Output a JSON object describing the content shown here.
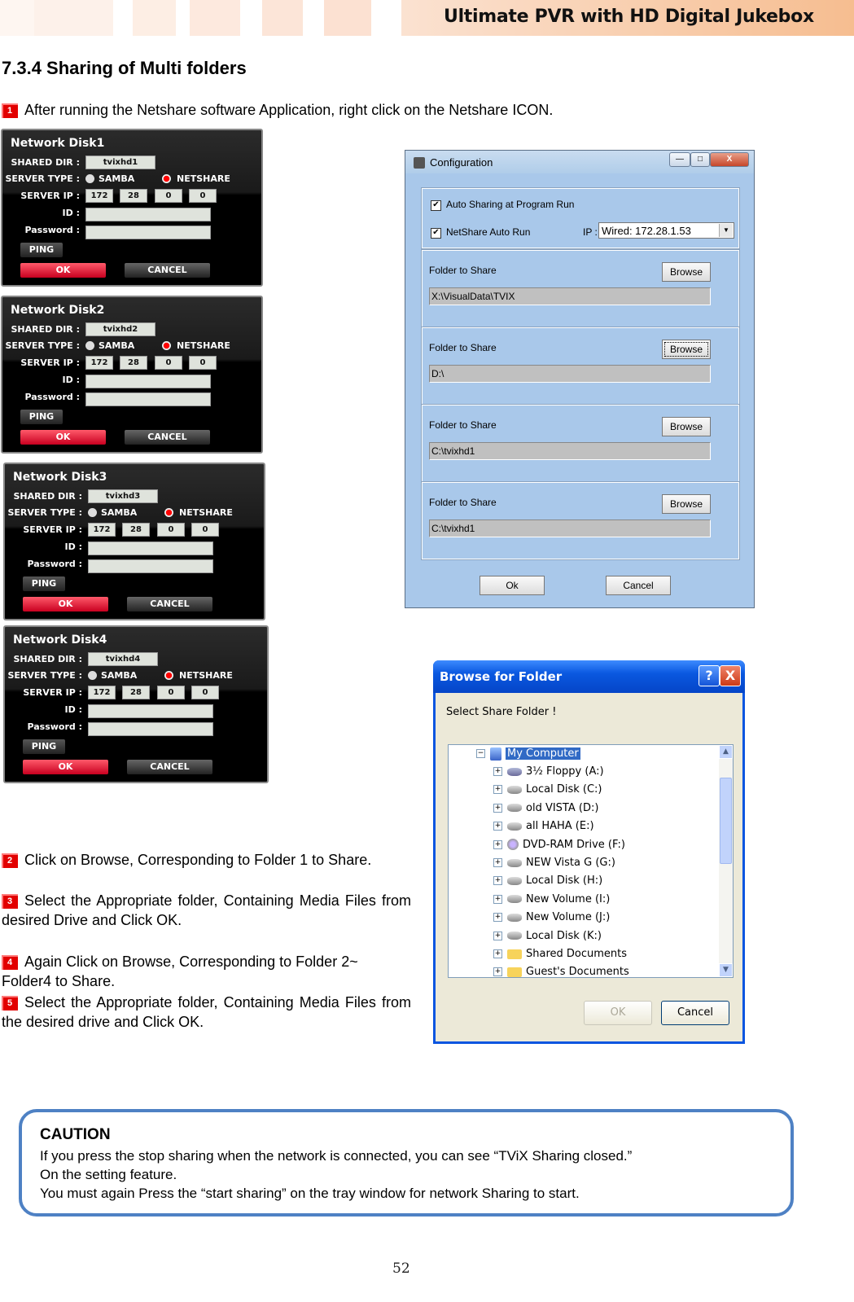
{
  "header": {
    "title": "Ultimate PVR with HD Digital Jukebox",
    "band_color": "#f6bd90"
  },
  "section_title": "7.3.4 Sharing of Multi folders",
  "steps": [
    {
      "num": "1",
      "text": "After running the Netshare software Application, right click on the Netshare ICON."
    },
    {
      "num": "2",
      "text": "Click on Browse, Corresponding to Folder 1 to Share."
    },
    {
      "num": "3",
      "text": "Select the Appropriate folder, Containing Media Files from desired Drive and Click OK."
    },
    {
      "num": "4",
      "text": "Again Click on Browse, Corresponding to Folder 2~ Folder4 to Share."
    },
    {
      "num": "5",
      "text": "Select the Appropriate folder, Containing Media Files from the desired drive and Click OK."
    }
  ],
  "network_disks": [
    {
      "title": "Network Disk1",
      "shared_dir": "tvixhd1",
      "ip": [
        "172",
        "28",
        "0",
        "0"
      ]
    },
    {
      "title": "Network Disk2",
      "shared_dir": "tvixhd2",
      "ip": [
        "172",
        "28",
        "0",
        "0"
      ]
    },
    {
      "title": "Network Disk3",
      "shared_dir": "tvixhd3",
      "ip": [
        "172",
        "28",
        "0",
        "0"
      ]
    },
    {
      "title": "Network Disk4",
      "shared_dir": "tvixhd4",
      "ip": [
        "172",
        "28",
        "0",
        "0"
      ]
    }
  ],
  "disk_labels": {
    "shared_dir": "SHARED DIR  :",
    "server_type": "SERVER TYPE :",
    "server_ip": "SERVER IP :",
    "id": "ID :",
    "password": "Password :",
    "samba": "SAMBA",
    "netshare": "NETSHARE",
    "selected_type": "NETSHARE",
    "ping": "PING",
    "ok": "OK",
    "cancel": "CANCEL"
  },
  "config_window": {
    "title": "Configuration",
    "minimize": "—",
    "maximize": "□",
    "close": "X",
    "auto_sharing_label": "Auto Sharing at Program Run",
    "auto_sharing_checked": true,
    "netshare_autorun_label": "NetShare  Auto Run",
    "netshare_autorun_checked": true,
    "ip_label": "IP :",
    "ip_value": "Wired: 172.28.1.53",
    "folders": [
      {
        "label": "Folder to Share",
        "path": "X:\\VisualData\\TVIX",
        "browse": "Browse"
      },
      {
        "label": "Folder to Share",
        "path": "D:\\",
        "browse": "Browse"
      },
      {
        "label": "Folder to Share",
        "path": "C:\\tvixhd1",
        "browse": "Browse"
      },
      {
        "label": "Folder to Share",
        "path": "C:\\tvixhd1",
        "browse": "Browse"
      }
    ],
    "ok": "Ok",
    "cancel": "Cancel"
  },
  "browse_dialog": {
    "title": "Browse for Folder",
    "help": "?",
    "close": "X",
    "prompt": "Select Share Folder !",
    "root": "My Computer",
    "items": [
      {
        "label": "3½ Floppy (A:)",
        "icon": "floppy"
      },
      {
        "label": "Local Disk (C:)",
        "icon": "drive"
      },
      {
        "label": "old VISTA (D:)",
        "icon": "drive"
      },
      {
        "label": "all HAHA (E:)",
        "icon": "drive"
      },
      {
        "label": "DVD-RAM Drive (F:)",
        "icon": "dvd"
      },
      {
        "label": "NEW Vista G (G:)",
        "icon": "drive"
      },
      {
        "label": "Local Disk (H:)",
        "icon": "drive"
      },
      {
        "label": "New Volume (I:)",
        "icon": "drive"
      },
      {
        "label": "New Volume (J:)",
        "icon": "drive"
      },
      {
        "label": "Local Disk (K:)",
        "icon": "drive"
      },
      {
        "label": "Shared Documents",
        "icon": "folder"
      },
      {
        "label": "Guest's Documents",
        "icon": "folder"
      }
    ],
    "ok": "OK",
    "cancel": "Cancel"
  },
  "caution": {
    "title": "CAUTION",
    "lines": [
      "If you press the stop sharing when the network is connected, you can see “TViX Sharing closed.”",
      "On the setting feature.",
      "You must again Press the “start sharing” on the tray window for network Sharing to start."
    ]
  },
  "page_number": "52"
}
